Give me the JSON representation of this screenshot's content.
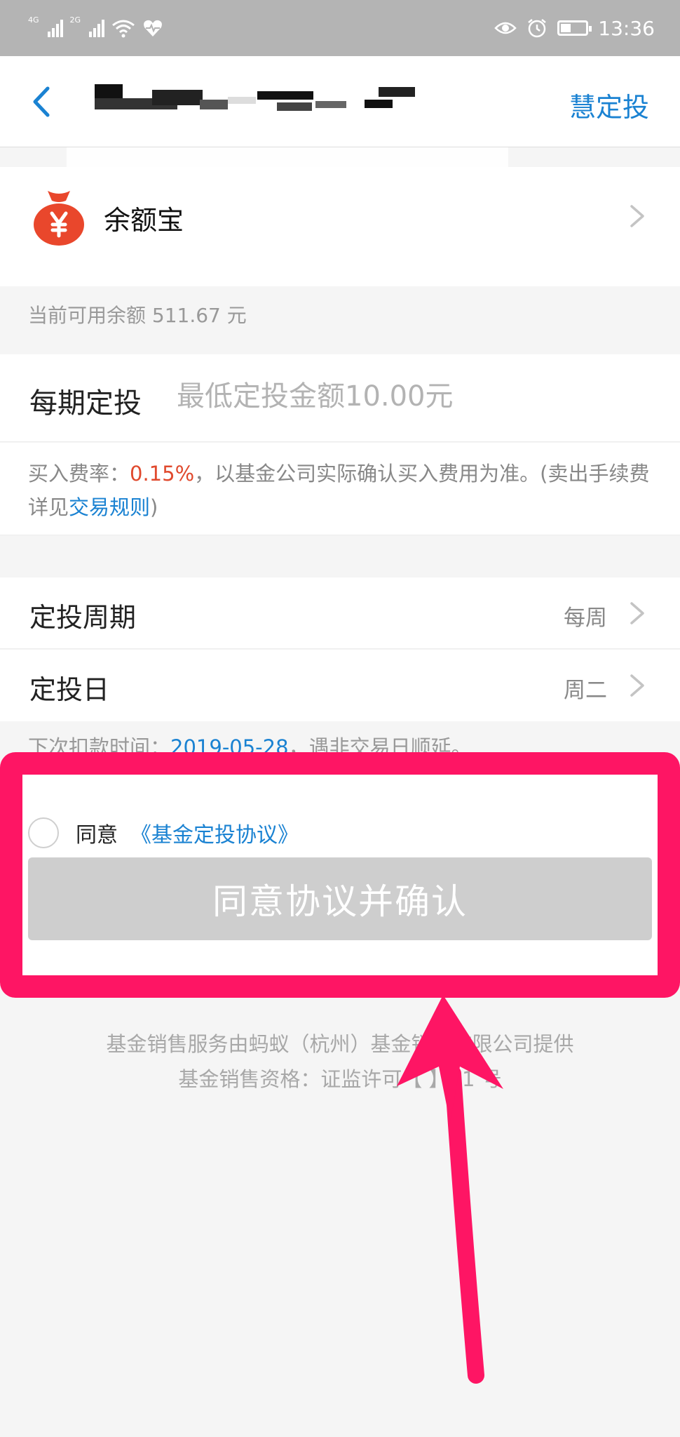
{
  "status_bar": {
    "network_1": "4G",
    "network_2": "2G",
    "time": "13:36"
  },
  "nav": {
    "title": "",
    "right_link": "慧定投"
  },
  "account": {
    "name": "余额宝",
    "icon": "money-bag-yen-icon"
  },
  "balance_text": "当前可用余额 511.67 元",
  "amount": {
    "label": "每期定投",
    "placeholder": "最低定投金额10.00元",
    "value": ""
  },
  "fee": {
    "prefix": "买入费率：",
    "rate": "0.15%",
    "middle": "，以基金公司实际确认买入费用为准。(卖出手续费详见",
    "link": "交易规则",
    "suffix": ")"
  },
  "period": {
    "label": "定投周期",
    "value": "每周"
  },
  "day": {
    "label": "定投日",
    "value": "周二"
  },
  "next_deduct": {
    "prefix": "下次扣款时间：",
    "date": "2019-05-28",
    "suffix": "，遇非交易日顺延。"
  },
  "agreement": {
    "agree_text": "同意",
    "link_text": "《基金定投协议》",
    "checked": false
  },
  "confirm_button": "同意协议并确认",
  "footer": {
    "line1": "基金销售服务由蚂蚁（杭州）基金销售有限公司提供",
    "line2": "基金销售资格：证监许可【 】21 号"
  },
  "colors": {
    "accent": "#1a82d2",
    "highlight": "#fe1564",
    "fee_rate": "#e0492d",
    "button_disabled": "#cecece"
  }
}
